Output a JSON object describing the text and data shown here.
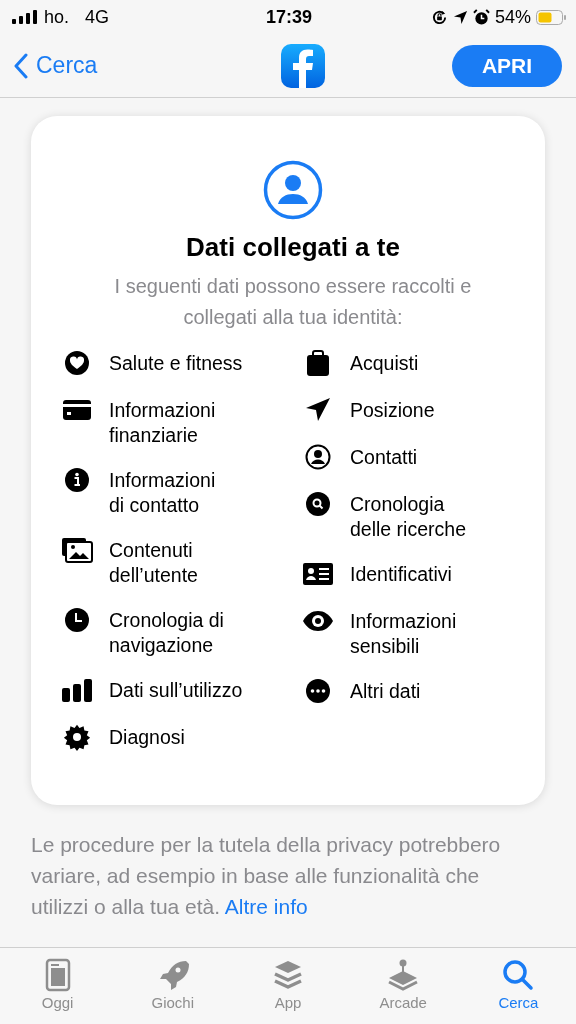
{
  "status_bar": {
    "carrier": "ho.",
    "network": "4G",
    "time": "17:39",
    "battery": "54%"
  },
  "nav": {
    "back": "Cerca",
    "action": "APRI"
  },
  "card": {
    "title": "Dati collegati a te",
    "subtitle": "I seguenti dati possono essere raccolti e collegati alla tua identità:",
    "columns": [
      [
        {
          "kind": "heart",
          "lines": [
            "Salute e fitness"
          ]
        },
        {
          "kind": "card",
          "lines": [
            "Informazioni",
            "finanziarie"
          ]
        },
        {
          "kind": "info",
          "lines": [
            "Informazioni",
            "di contatto"
          ]
        },
        {
          "kind": "photos",
          "lines": [
            "Contenuti",
            "dell’utente"
          ]
        },
        {
          "kind": "clock",
          "lines": [
            "Cronologia di",
            "navigazione"
          ]
        },
        {
          "kind": "bars",
          "lines": [
            "Dati sull’utilizzo"
          ]
        },
        {
          "kind": "gear",
          "lines": [
            "Diagnosi"
          ]
        }
      ],
      [
        {
          "kind": "bag",
          "lines": [
            "Acquisti"
          ]
        },
        {
          "kind": "arrow",
          "lines": [
            "Posizione"
          ]
        },
        {
          "kind": "person",
          "lines": [
            "Contatti"
          ]
        },
        {
          "kind": "search",
          "lines": [
            "Cronologia",
            "delle ricerche"
          ]
        },
        {
          "kind": "idcard",
          "lines": [
            "Identificativi"
          ]
        },
        {
          "kind": "eye",
          "lines": [
            "Informazioni",
            "sensibili"
          ]
        },
        {
          "kind": "dots",
          "lines": [
            "Altri dati"
          ]
        }
      ]
    ]
  },
  "footer": {
    "text": "Le procedure per la tutela della privacy potrebbero variare, ad esempio in base alle funzionalità che utilizzi o alla tua età.",
    "link": "Altre info"
  },
  "tabs": [
    {
      "kind": "today",
      "label": "Oggi",
      "selected": false
    },
    {
      "kind": "rocket",
      "label": "Giochi",
      "selected": false
    },
    {
      "kind": "layers",
      "label": "App",
      "selected": false
    },
    {
      "kind": "joystick",
      "label": "Arcade",
      "selected": false
    },
    {
      "kind": "search",
      "label": "Cerca",
      "selected": true
    }
  ]
}
